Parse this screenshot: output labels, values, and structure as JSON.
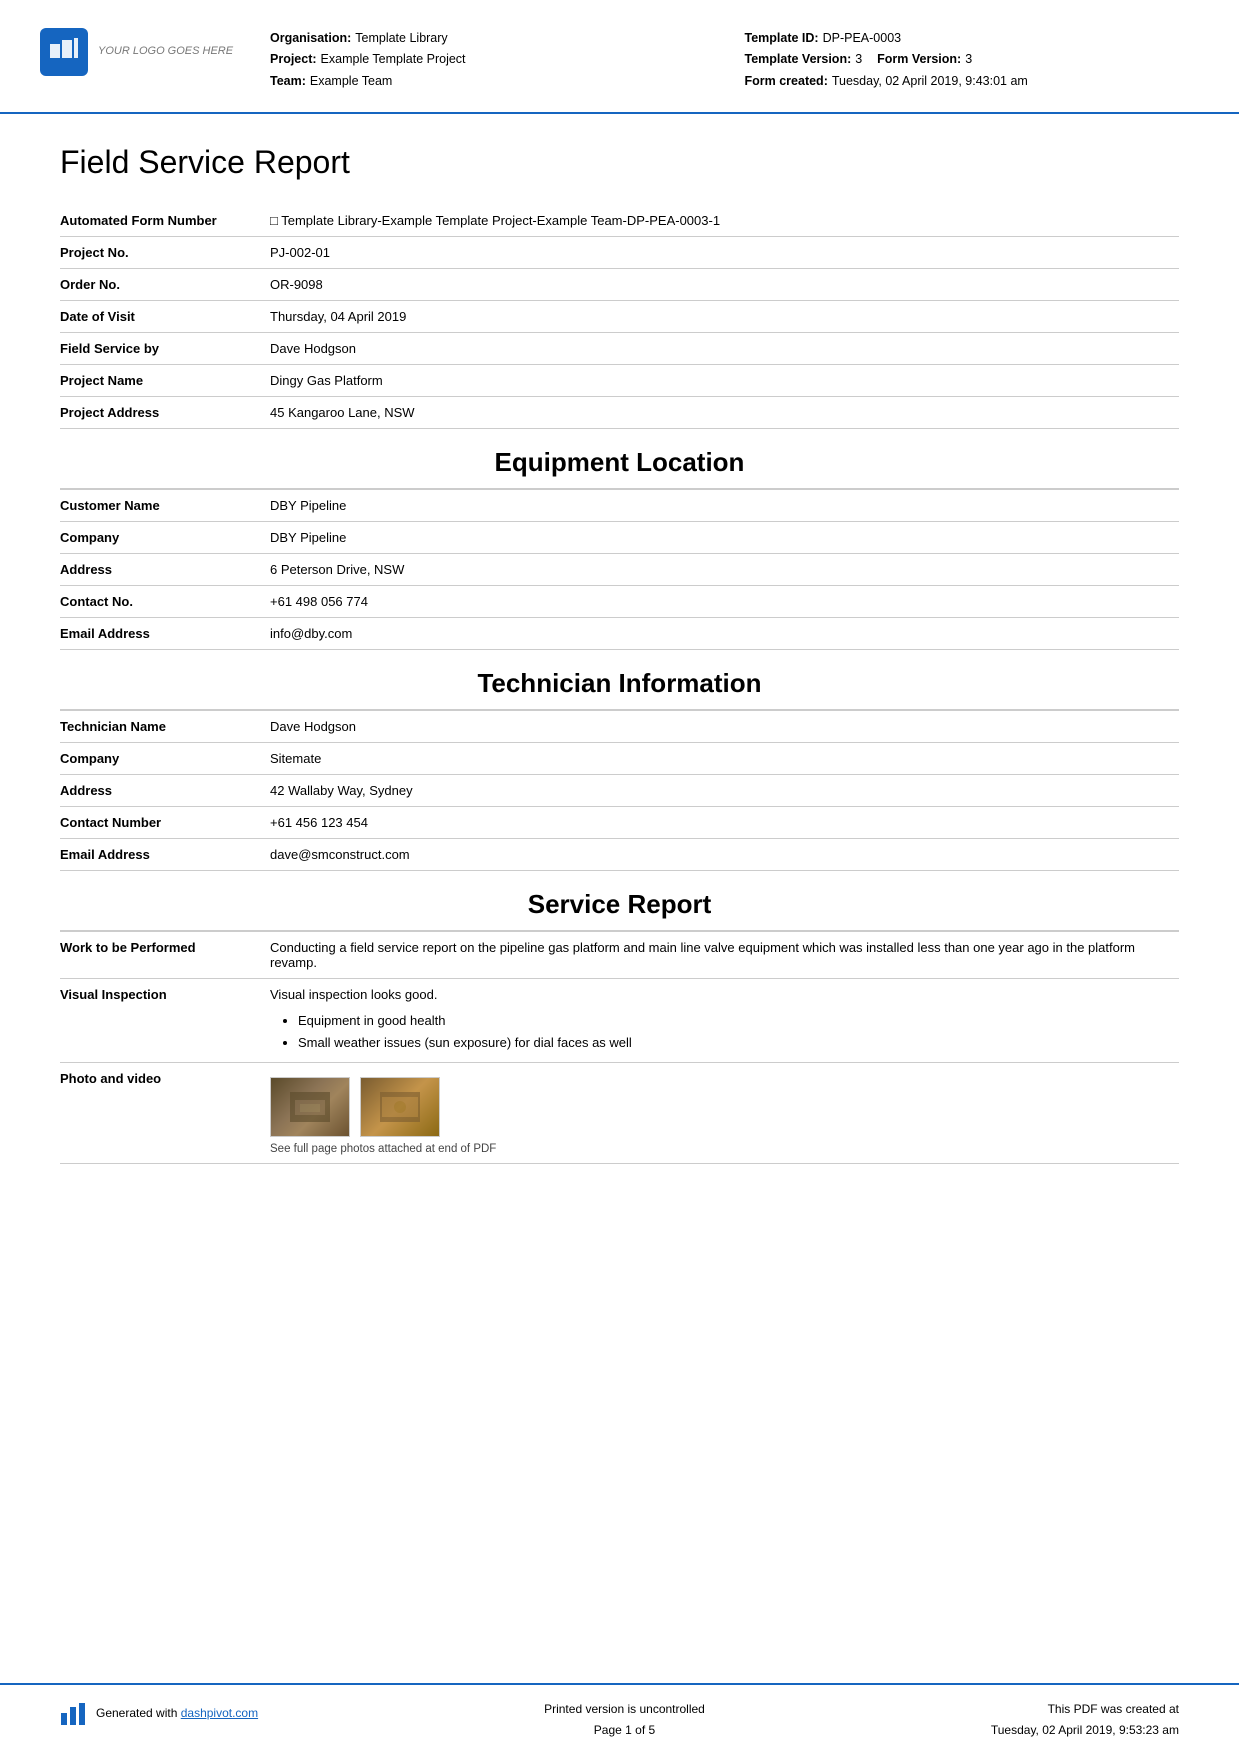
{
  "header": {
    "logo_alt": "YOUR LOGO GOES HERE",
    "org_label": "Organisation:",
    "org_value": "Template Library",
    "project_label": "Project:",
    "project_value": "Example Template Project",
    "team_label": "Team:",
    "team_value": "Example Team",
    "template_id_label": "Template ID:",
    "template_id_value": "DP-PEA-0003",
    "template_version_label": "Template Version:",
    "template_version_value": "3",
    "form_version_label": "Form Version:",
    "form_version_value": "3",
    "form_created_label": "Form created:",
    "form_created_value": "Tuesday, 02 April 2019, 9:43:01 am"
  },
  "page_title": "Field Service Report",
  "form_fields": [
    {
      "label": "Automated Form Number",
      "value": "□ Template Library-Example Template Project-Example Team-DP-PEA-0003-1"
    },
    {
      "label": "Project No.",
      "value": "PJ-002-01"
    },
    {
      "label": "Order No.",
      "value": "OR-9098"
    },
    {
      "label": "Date of Visit",
      "value": "Thursday, 04 April 2019"
    },
    {
      "label": "Field Service by",
      "value": "Dave Hodgson"
    },
    {
      "label": "Project Name",
      "value": "Dingy Gas Platform"
    },
    {
      "label": "Project Address",
      "value": "45 Kangaroo Lane, NSW"
    }
  ],
  "equipment_location": {
    "heading": "Equipment Location",
    "fields": [
      {
        "label": "Customer Name",
        "value": "DBY Pipeline"
      },
      {
        "label": "Company",
        "value": "DBY Pipeline"
      },
      {
        "label": "Address",
        "value": "6 Peterson Drive, NSW"
      },
      {
        "label": "Contact No.",
        "value": "+61 498 056 774"
      },
      {
        "label": "Email Address",
        "value": "info@dby.com"
      }
    ]
  },
  "technician_information": {
    "heading": "Technician Information",
    "fields": [
      {
        "label": "Technician Name",
        "value": "Dave Hodgson"
      },
      {
        "label": "Company",
        "value": "Sitemate"
      },
      {
        "label": "Address",
        "value": "42 Wallaby Way, Sydney"
      },
      {
        "label": "Contact Number",
        "value": "+61 456 123 454"
      },
      {
        "label": "Email Address",
        "value": "dave@smconstruct.com"
      }
    ]
  },
  "service_report": {
    "heading": "Service Report",
    "fields": [
      {
        "label": "Work to be Performed",
        "value": "Conducting a field service report on the pipeline gas platform and main line valve equipment which was installed less than one year ago in the platform revamp."
      },
      {
        "label": "Visual Inspection",
        "intro": "Visual inspection looks good.",
        "bullets": [
          "Equipment in good health",
          "Small weather issues (sun exposure) for dial faces as well"
        ]
      },
      {
        "label": "Photo and video",
        "caption": "See full page photos attached at end of PDF"
      }
    ]
  },
  "footer": {
    "generated_with_prefix": "Generated with ",
    "dashpivot_link": "dashpivot.com",
    "uncontrolled_label": "Printed version is uncontrolled",
    "page_label": "Page 1 of 5",
    "pdf_created_label": "This PDF was created at",
    "pdf_created_value": "Tuesday, 02 April 2019, 9:53:23 am"
  }
}
